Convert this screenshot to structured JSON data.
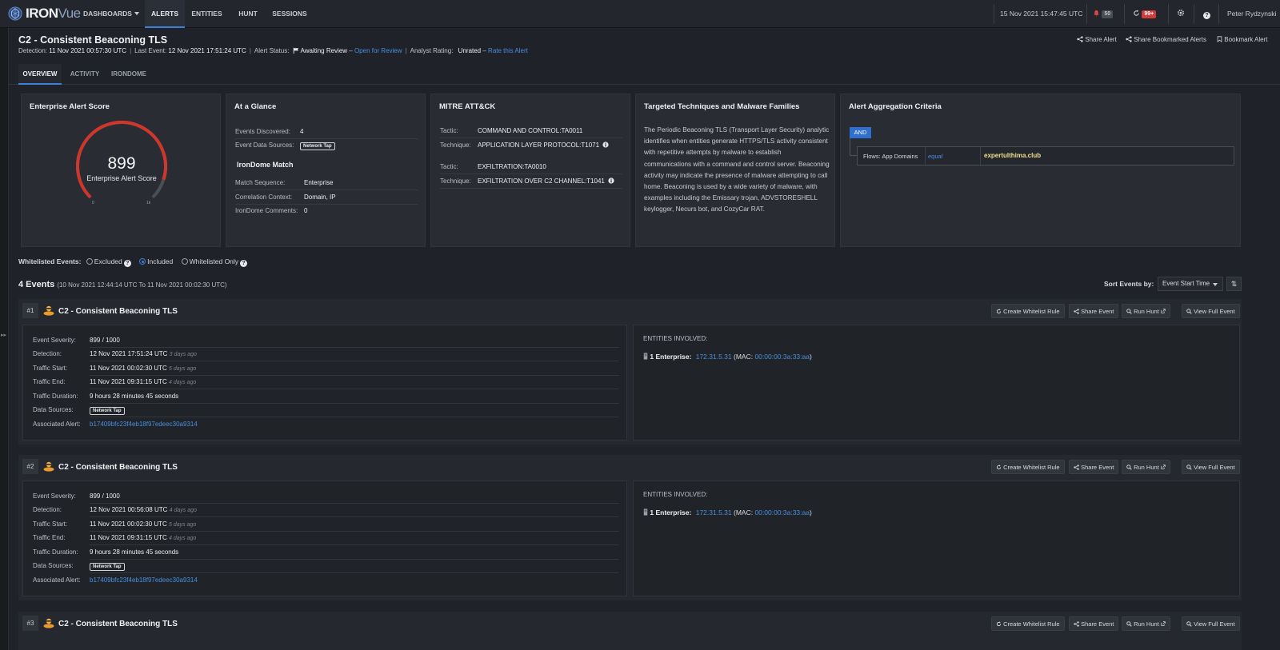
{
  "app": {
    "logo_bold": "IRON",
    "logo_light": "Vue"
  },
  "nav": {
    "dashboards": "DASHBOARDS",
    "alerts": "ALERTS",
    "entities": "ENTITIES",
    "hunt": "HUNT",
    "sessions": "SESSIONS"
  },
  "topbar": {
    "datetime": "15 Nov 2021 15:47:45 UTC",
    "notif_count": "50",
    "refresh_count": "99+",
    "user": "Peter Rydzynski"
  },
  "alert": {
    "title": "C2 - Consistent Beaconing TLS",
    "detection_label": "Detection:",
    "detection": "11 Nov 2021 00:57:30 UTC",
    "last_event_label": "Last Event:",
    "last_event": "12 Nov 2021 17:51:24 UTC",
    "status_label": "Alert Status:",
    "status": "Awaiting Review",
    "status_link": "Open for Review",
    "rating_label": "Analyst Rating:",
    "rating": "Unrated",
    "rating_link": "Rate this Alert",
    "actions": {
      "share": "Share Alert",
      "share_bookmarked": "Share Bookmarked Alerts",
      "bookmark": "Bookmark Alert"
    }
  },
  "tabs": {
    "overview": "OVERVIEW",
    "activity": "ACTIVITY",
    "irondome": "IRONDOME"
  },
  "score_card": {
    "title": "Enterprise Alert Score",
    "score": "899",
    "label": "Enterprise Alert Score",
    "min": "0",
    "max": "1k",
    "fraction": 0.899
  },
  "glance": {
    "title": "At a Glance",
    "events_label": "Events Discovered:",
    "events": "4",
    "sources_label": "Event Data Sources:",
    "source_tag": "Network Tap",
    "irondome_title": "IronDome Match",
    "match_label": "Match Sequence:",
    "match": "Enterprise",
    "corr_label": "Correlation Context:",
    "corr": "Domain, IP",
    "comments_label": "IronDome Comments:",
    "comments": "0"
  },
  "mitre": {
    "title": "MITRE ATT&CK",
    "tactic_label": "Tactic:",
    "technique_label": "Technique:",
    "tactic1": "COMMAND AND CONTROL:TA0011",
    "technique1": "APPLICATION LAYER PROTOCOL:T1071",
    "tactic2": "EXFILTRATION:TA0010",
    "technique2": "EXFILTRATION OVER C2 CHANNEL:T1041"
  },
  "techniques": {
    "title": "Targeted Techniques and Malware Families",
    "text": "The Periodic Beaconing TLS (Transport Layer Security) analytic identifies when entities generate HTTPS/TLS activity consistent with repetitive attempts by malware to establish communications with a command and control server. Beaconing activity may indicate the presence of malware attempting to call home. Beaconing is used by a wide variety of malware, with examples including the Emissary trojan, ADVSTORESHELL keylogger, Necurs bot, and CozyCar RAT."
  },
  "aggregation": {
    "title": "Alert Aggregation Criteria",
    "op": "AND",
    "field": "Flows: App Domains",
    "comparator": "equal",
    "value": "expertulthima.club"
  },
  "whitelist": {
    "label": "Whitelisted Events:",
    "excluded": "Excluded",
    "included": "Included",
    "only": "Whitelisted Only"
  },
  "events_header": {
    "count": "4 Events",
    "range": "(10 Nov 2021 12:44:14 UTC To 11 Nov 2021 00:02:30 UTC)",
    "sort_label": "Sort Events by:",
    "sort_value": "Event Start Time"
  },
  "event_labels": {
    "severity": "Event Severity:",
    "detection": "Detection:",
    "traffic_start": "Traffic Start:",
    "traffic_end": "Traffic End:",
    "duration": "Traffic Duration:",
    "sources": "Data Sources:",
    "assoc": "Associated Alert:",
    "entities": "ENTITIES INVOLVED:",
    "btn_whitelist": "Create Whitelist Rule",
    "btn_share": "Share Event",
    "btn_hunt": "Run Hunt",
    "btn_view": "View Full Event"
  },
  "events": [
    {
      "num": "#1",
      "title": "C2 - Consistent Beaconing TLS",
      "severity": "899 / 1000",
      "detection": "12 Nov 2021 17:51:24 UTC",
      "detection_ago": "3 days ago",
      "traffic_start": "11 Nov 2021 00:02:30 UTC",
      "traffic_start_ago": "5 days ago",
      "traffic_end": "11 Nov 2021 09:31:15 UTC",
      "traffic_end_ago": "4 days ago",
      "duration": "9 hours 28 minutes 45 seconds",
      "source_tag": "Network Tap",
      "assoc": "b17409bfc23f4eb18f97edeec30a9314",
      "entity_label": "1 Enterprise:",
      "entity_ip": "172.31.5.31",
      "entity_mac": "00:00:00:3a:33:aa"
    },
    {
      "num": "#2",
      "title": "C2 - Consistent Beaconing TLS",
      "severity": "899 / 1000",
      "detection": "12 Nov 2021 00:56:08 UTC",
      "detection_ago": "4 days ago",
      "traffic_start": "11 Nov 2021 00:02:30 UTC",
      "traffic_start_ago": "5 days ago",
      "traffic_end": "11 Nov 2021 09:31:15 UTC",
      "traffic_end_ago": "4 days ago",
      "duration": "9 hours 28 minutes 45 seconds",
      "source_tag": "Network Tap",
      "assoc": "b17409bfc23f4eb18f97edeec30a9314",
      "entity_label": "1 Enterprise:",
      "entity_ip": "172.31.5.31",
      "entity_mac": "00:00:00:3a:33:aa"
    },
    {
      "num": "#3",
      "title": "C2 - Consistent Beaconing TLS"
    }
  ],
  "colors": {
    "accent": "#3b82d6",
    "gauge": "#d0362c",
    "danger": "#d33a3a",
    "link": "#4a8fe0",
    "agg_value": "#f3df8a"
  },
  "icons": [
    "logo-icon",
    "bell-icon",
    "refresh-icon",
    "gear-icon",
    "help-icon",
    "share-icon",
    "bookmark-icon",
    "flag-icon",
    "info-icon",
    "threat-actor-icon",
    "search-icon",
    "external-link-icon",
    "sort-icon",
    "server-icon"
  ]
}
